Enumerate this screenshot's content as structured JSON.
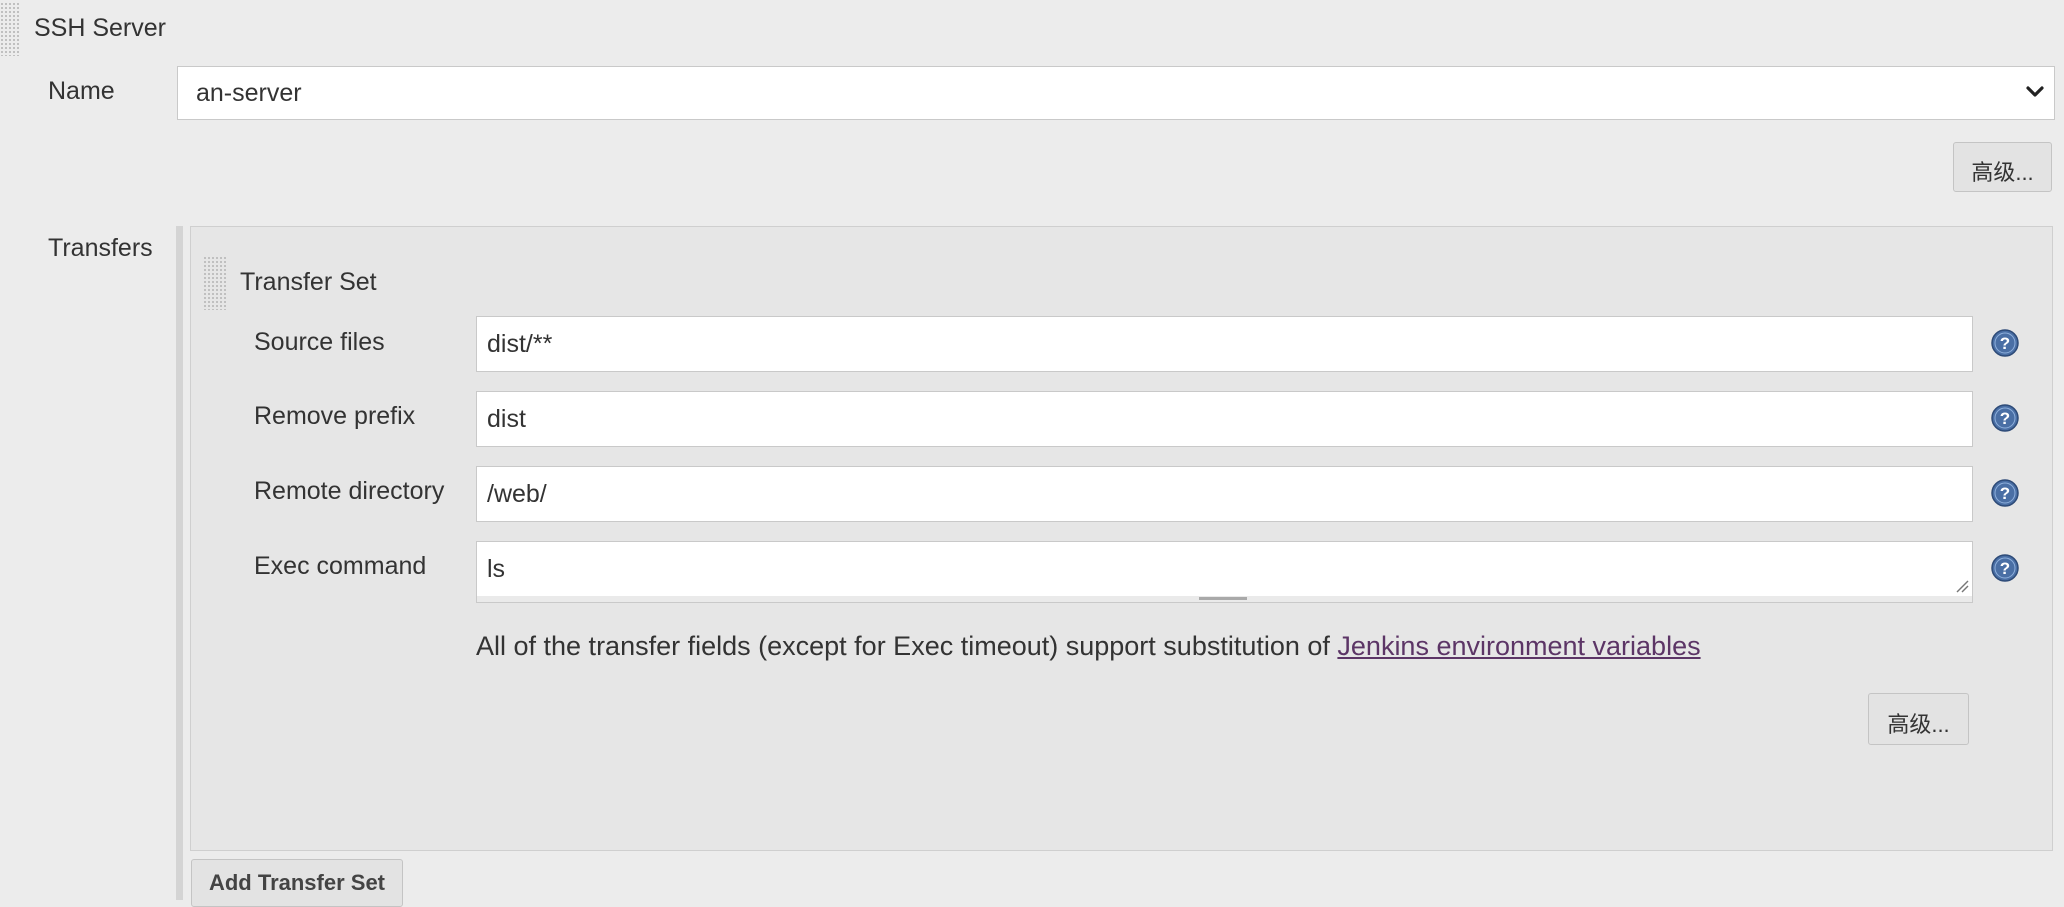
{
  "ssh_server": {
    "title": "SSH Server",
    "name_label": "Name",
    "name_value": "an-server",
    "advanced_button": "高级..."
  },
  "transfers": {
    "label": "Transfers",
    "transfer_set": {
      "title": "Transfer Set",
      "source_files_label": "Source files",
      "source_files_value": "dist/**",
      "remove_prefix_label": "Remove prefix",
      "remove_prefix_value": "dist",
      "remote_directory_label": "Remote directory",
      "remote_directory_value": "/web/",
      "exec_command_label": "Exec command",
      "exec_command_value": "ls",
      "note_text": "All of the transfer fields (except for Exec timeout) support substitution of ",
      "note_link": "Jenkins environment variables",
      "advanced_button": "高级..."
    },
    "add_button": "Add Transfer Set"
  },
  "icons": {
    "help": "help-icon",
    "chevron": "chevron-down-icon",
    "grip": "drag-handle-icon"
  },
  "colors": {
    "background": "#ececec",
    "panel": "#e6e6e6",
    "link": "#5c3566",
    "help_blue": "#4a6fa5"
  }
}
